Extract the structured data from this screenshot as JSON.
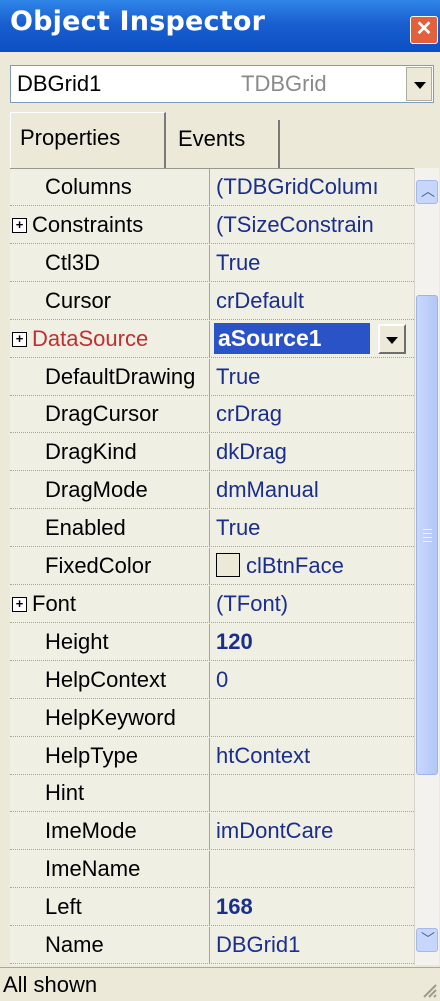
{
  "window": {
    "title": "Object Inspector",
    "close_glyph": "✕"
  },
  "component_combo": {
    "name": "DBGrid1",
    "type": "TDBGrid"
  },
  "tabs": [
    {
      "label": "Properties",
      "active": true
    },
    {
      "label": "Events",
      "active": false
    }
  ],
  "properties": [
    {
      "name": "Columns",
      "value": "(TDBGridColumı",
      "expandable": false
    },
    {
      "name": "Constraints",
      "value": "(TSizeConstrain",
      "expandable": true
    },
    {
      "name": "Ctl3D",
      "value": "True",
      "expandable": false
    },
    {
      "name": "Cursor",
      "value": "crDefault",
      "expandable": false
    },
    {
      "name": "DataSource",
      "value": "aSource1",
      "expandable": true,
      "selected": true
    },
    {
      "name": "DefaultDrawing",
      "value": "True",
      "expandable": false
    },
    {
      "name": "DragCursor",
      "value": "crDrag",
      "expandable": false
    },
    {
      "name": "DragKind",
      "value": "dkDrag",
      "expandable": false
    },
    {
      "name": "DragMode",
      "value": "dmManual",
      "expandable": false
    },
    {
      "name": "Enabled",
      "value": "True",
      "expandable": false
    },
    {
      "name": "FixedColor",
      "value": "clBtnFace",
      "expandable": false,
      "swatch": "#ece9d8"
    },
    {
      "name": "Font",
      "value": "(TFont)",
      "expandable": true
    },
    {
      "name": "Height",
      "value": "120",
      "expandable": false,
      "bold": true
    },
    {
      "name": "HelpContext",
      "value": "0",
      "expandable": false
    },
    {
      "name": "HelpKeyword",
      "value": "",
      "expandable": false
    },
    {
      "name": "HelpType",
      "value": "htContext",
      "expandable": false
    },
    {
      "name": "Hint",
      "value": "",
      "expandable": false
    },
    {
      "name": "ImeMode",
      "value": "imDontCare",
      "expandable": false
    },
    {
      "name": "ImeName",
      "value": "",
      "expandable": false
    },
    {
      "name": "Left",
      "value": "168",
      "expandable": false,
      "bold": true
    },
    {
      "name": "Name",
      "value": "DBGrid1",
      "expandable": false
    }
  ],
  "status_bar": {
    "text": "All shown"
  },
  "colors": {
    "title_bar": "#0b4fc4",
    "value_text": "#1a2e8c",
    "selected_name": "#c03030",
    "selection_bg": "#2a53c8"
  }
}
